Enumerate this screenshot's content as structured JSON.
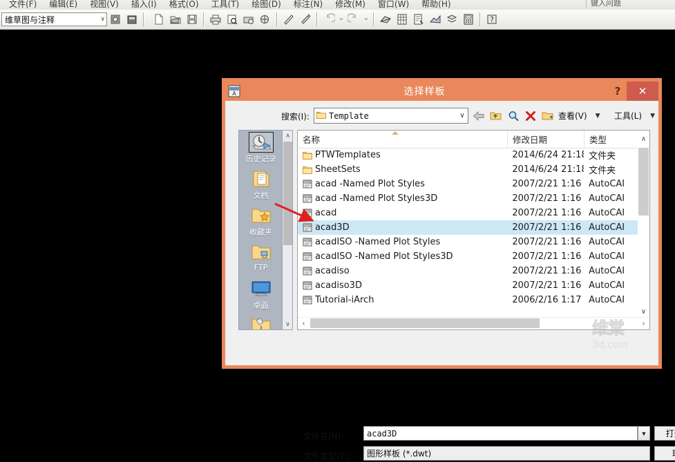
{
  "app": {
    "menus": [
      {
        "label": "文件(F)"
      },
      {
        "label": "编辑(E)"
      },
      {
        "label": "视图(V)"
      },
      {
        "label": "插入(I)"
      },
      {
        "label": "格式(O)"
      },
      {
        "label": "工具(T)"
      },
      {
        "label": "绘图(D)"
      },
      {
        "label": "标注(N)"
      },
      {
        "label": "修改(M)"
      },
      {
        "label": "窗口(W)"
      },
      {
        "label": "帮助(H)"
      }
    ],
    "help_search_placeholder": "键入问题",
    "workspace": {
      "value": "维草图与注释",
      "caret": "∨"
    },
    "toolbar_icons": [
      "workspace-settings-icon",
      "workspace-label-icon",
      "new-file-icon",
      "open-file-icon",
      "save-icon",
      "plot-icon",
      "plot-preview-icon",
      "publish-icon",
      "3dprint-icon",
      "cut-icon",
      "match-properties-icon",
      "undo-icon",
      "redo-icon",
      "xref-icon",
      "block-table-icon",
      "attribute-icon",
      "render-icon",
      "layers-icon",
      "calculator-icon",
      "help-icon"
    ]
  },
  "dialog": {
    "title": "选择样板",
    "icon": "autocad-dwt-icon",
    "help_label": "?",
    "close_label": "✕",
    "frame_color": "#e8885b",
    "close_color": "#cf5b4e",
    "search": {
      "label": "搜索(I):",
      "path": "Template",
      "caret": "∨"
    },
    "nav_icons": [
      {
        "name": "back-arrow-icon"
      },
      {
        "name": "up-folder-icon"
      },
      {
        "name": "search-icon"
      },
      {
        "name": "delete-icon"
      },
      {
        "name": "new-folder-icon"
      }
    ],
    "view_menu": {
      "label": "查看(V)",
      "caret": "▼"
    },
    "tools_menu": {
      "label": "工具(L)",
      "caret": "▼"
    },
    "places": [
      {
        "label": "历史记录",
        "icon": "history-icon",
        "selected": true
      },
      {
        "label": "文档",
        "icon": "documents-icon",
        "selected": false
      },
      {
        "label": "收藏夹",
        "icon": "favorites-icon",
        "selected": false
      },
      {
        "label": "FTP",
        "icon": "ftp-icon",
        "selected": false
      },
      {
        "label": "桌面",
        "icon": "desktop-icon",
        "selected": false
      },
      {
        "label": "",
        "icon": "buzzsaw-folder-icon",
        "selected": false
      }
    ],
    "columns": [
      {
        "label": "名称",
        "sorted": "asc"
      },
      {
        "label": "修改日期",
        "sorted": ""
      },
      {
        "label": "类型",
        "sorted": ""
      }
    ],
    "files": [
      {
        "name": "PTWTemplates",
        "date": "2014/6/24 21:18",
        "type": "文件夹",
        "icon": "folder-icon",
        "selected": false
      },
      {
        "name": "SheetSets",
        "date": "2014/6/24 21:18",
        "type": "文件夹",
        "icon": "folder-icon",
        "selected": false
      },
      {
        "name": "acad -Named Plot Styles",
        "date": "2007/2/21 1:16",
        "type": "AutoCAI",
        "icon": "dwt-icon",
        "selected": false
      },
      {
        "name": "acad -Named Plot Styles3D",
        "date": "2007/2/21 1:16",
        "type": "AutoCAI",
        "icon": "dwt-icon",
        "selected": false
      },
      {
        "name": "acad",
        "date": "2007/2/21 1:16",
        "type": "AutoCAI",
        "icon": "dwt-icon",
        "selected": false
      },
      {
        "name": "acad3D",
        "date": "2007/2/21 1:16",
        "type": "AutoCAI",
        "icon": "dwt-icon",
        "selected": true
      },
      {
        "name": "acadISO -Named Plot Styles",
        "date": "2007/2/21 1:16",
        "type": "AutoCAI",
        "icon": "dwt-icon",
        "selected": false
      },
      {
        "name": "acadISO -Named Plot Styles3D",
        "date": "2007/2/21 1:16",
        "type": "AutoCAI",
        "icon": "dwt-icon",
        "selected": false
      },
      {
        "name": "acadiso",
        "date": "2007/2/21 1:16",
        "type": "AutoCAI",
        "icon": "dwt-icon",
        "selected": false
      },
      {
        "name": "acadiso3D",
        "date": "2007/2/21 1:16",
        "type": "AutoCAI",
        "icon": "dwt-icon",
        "selected": false
      },
      {
        "name": "Tutorial-iArch",
        "date": "2006/2/16 1:17",
        "type": "AutoCAI",
        "icon": "dwt-icon",
        "selected": false
      }
    ],
    "selection_color": "#cde8f5",
    "filename": {
      "label": "文件名(N):",
      "value": "acad3D",
      "caret": "▼"
    },
    "filetype": {
      "label": "文件类型(T):",
      "value": "图形样板 (*.dwt)"
    },
    "open_button": "打开(O)",
    "cancel_button": "取消"
  },
  "watermark": {
    "top": "维棠",
    "bottom": "3d.com"
  }
}
